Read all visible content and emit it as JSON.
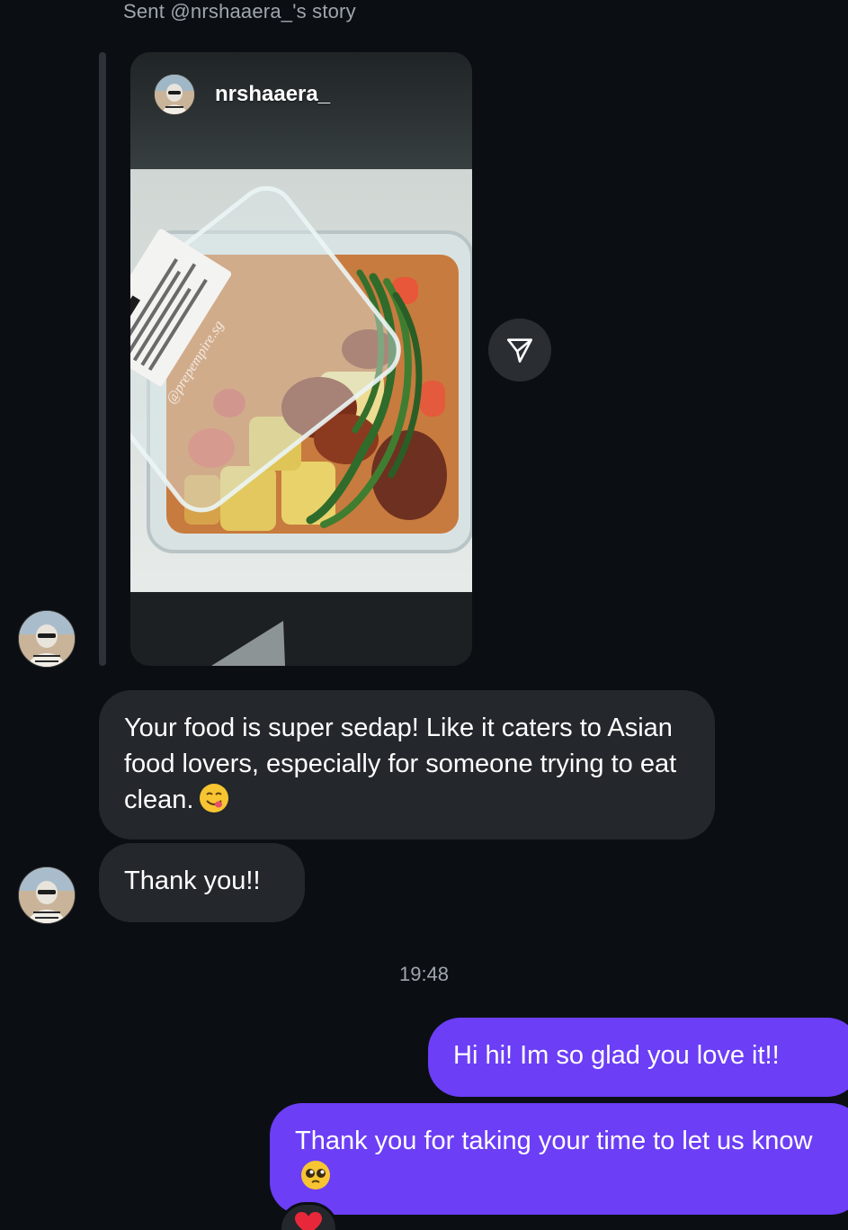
{
  "story": {
    "caption": "Sent @nrshaaera_'s story",
    "username": "nrshaaera_",
    "watermark": "@prepempire.sg"
  },
  "messages": [
    {
      "id": "m1",
      "direction": "incoming",
      "text": "Your food is super sedap! Like it caters to Asian food lovers, especially for someone trying to eat clean.",
      "emoji": "face-savoring-food"
    },
    {
      "id": "m2",
      "direction": "incoming",
      "text": "Thank you!!"
    },
    {
      "id": "m3",
      "direction": "outgoing",
      "text": "Hi hi! Im so glad you love it!!"
    },
    {
      "id": "m4",
      "direction": "outgoing",
      "text": "Thank you for taking your time to let us know",
      "emoji": "pleading-face"
    }
  ],
  "timestamp": "19:48",
  "reaction": {
    "icon": "red-heart-icon"
  },
  "icons": {
    "share": "send-icon"
  },
  "colors": {
    "background": "#0b0f14",
    "incoming_bubble": "#24272b",
    "outgoing_bubble": "#6c3ef6",
    "muted_text": "#a0a6ae"
  }
}
